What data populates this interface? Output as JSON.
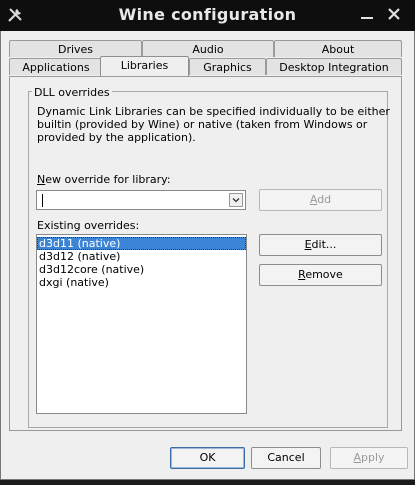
{
  "window": {
    "title": "Wine configuration"
  },
  "tabs_back": [
    "Drives",
    "Audio",
    "About"
  ],
  "tabs_front": [
    "Applications",
    "Libraries",
    "Graphics",
    "Desktop Integration"
  ],
  "dll": {
    "group_label": "DLL overrides",
    "description": [
      "Dynamic Link Libraries can be specified individually to be either",
      "builtin (provided by Wine) or native (taken from Windows or",
      "provided by the application)."
    ],
    "new_label_u": "N",
    "new_label_rest": "ew override for library:",
    "new_value": "",
    "add_u": "A",
    "add_rest": "dd",
    "existing_label": "Existing overrides:",
    "overrides": [
      "d3d11 (native)",
      "d3d12 (native)",
      "d3d12core (native)",
      "dxgi (native)"
    ],
    "selected_index": 0,
    "edit_u": "E",
    "edit_rest": "dit...",
    "remove_u": "R",
    "remove_rest": "emove"
  },
  "footer": {
    "ok": "OK",
    "cancel": "Cancel",
    "apply_u": "A",
    "apply_rest": "pply"
  }
}
